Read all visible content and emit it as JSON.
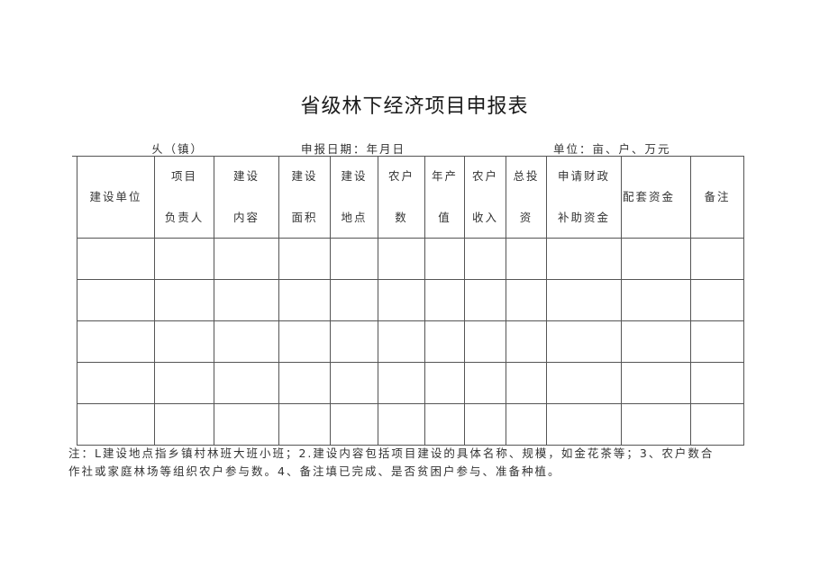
{
  "title": "省级林下经济项目申报表",
  "meta": {
    "township_suffix": "乆（镇）",
    "report_date": "申报日期：年月日",
    "unit": "单位：亩、户、万元"
  },
  "table": {
    "headers": [
      {
        "line1": "建设单位",
        "line2": ""
      },
      {
        "line1": "项目",
        "line2": "负责人"
      },
      {
        "line1": "建设",
        "line2": "内容"
      },
      {
        "line1": "建设",
        "line2": "面积"
      },
      {
        "line1": "建设",
        "line2": "地点"
      },
      {
        "line1": "农户",
        "line2": "数"
      },
      {
        "line1": "年产",
        "line2": "值"
      },
      {
        "line1": "农户",
        "line2": "收入"
      },
      {
        "line1": "总投",
        "line2": "资"
      },
      {
        "line1": "申请财政",
        "line2": "补助资金"
      },
      {
        "line1": "配套资金",
        "line2": ""
      },
      {
        "line1": "备注",
        "line2": ""
      }
    ],
    "rows": [
      [
        "",
        "",
        "",
        "",
        "",
        "",
        "",
        "",
        "",
        "",
        "",
        ""
      ],
      [
        "",
        "",
        "",
        "",
        "",
        "",
        "",
        "",
        "",
        "",
        "",
        ""
      ],
      [
        "",
        "",
        "",
        "",
        "",
        "",
        "",
        "",
        "",
        "",
        "",
        ""
      ],
      [
        "",
        "",
        "",
        "",
        "",
        "",
        "",
        "",
        "",
        "",
        "",
        ""
      ],
      [
        "",
        "",
        "",
        "",
        "",
        "",
        "",
        "",
        "",
        "",
        "",
        ""
      ]
    ]
  },
  "note": {
    "line1": "注：L建设地点指乡镇村林班大班小班；2.建设内容包括项目建设的具体名称、规模，如金花茶等；3、农户数合",
    "line2": "作社或家庭林场等组织农户参与数。4、备注填已完成、是否贫困户参与、准备种植。"
  }
}
